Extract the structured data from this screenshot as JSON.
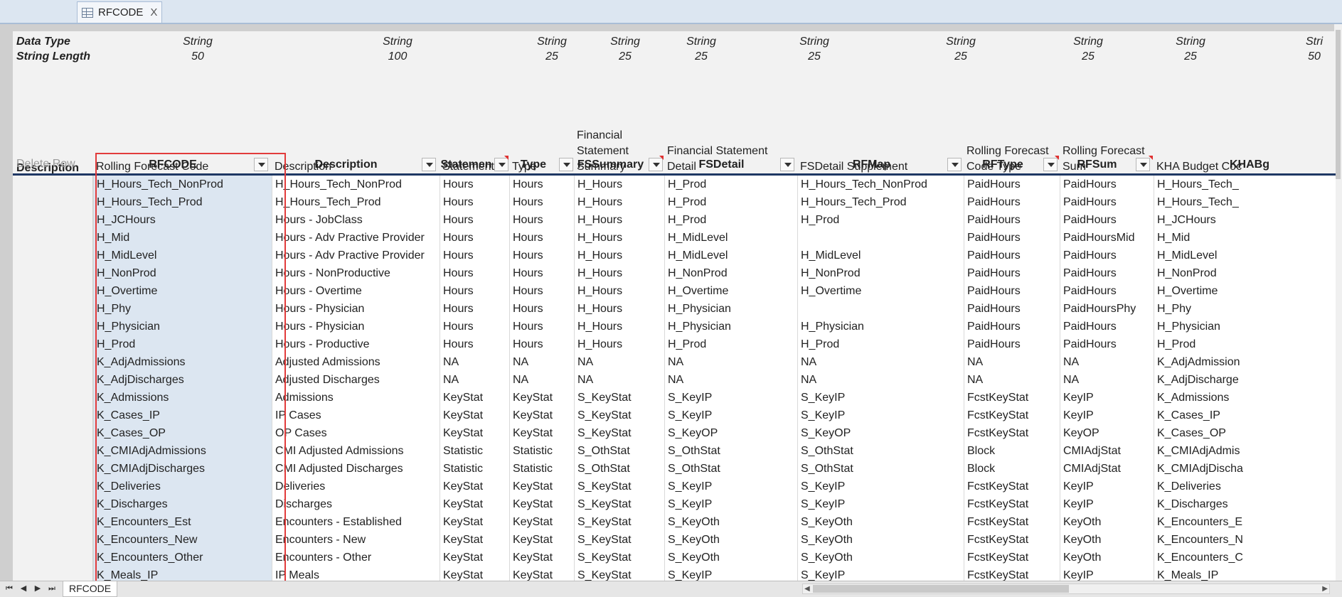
{
  "tab": {
    "title": "RFCODE",
    "close": "X"
  },
  "meta": {
    "data_type_label": "Data Type",
    "string_length_label": "String Length",
    "types": [
      "String",
      "String",
      "String",
      "String",
      "String",
      "String",
      "String",
      "String",
      "String",
      "Stri"
    ],
    "lengths": [
      "50",
      "100",
      "25",
      "25",
      "25",
      "25",
      "25",
      "25",
      "25",
      "50"
    ]
  },
  "description_label": "Description",
  "column_descriptions": [
    "Rolling Forecast Code",
    "Description",
    "Statement",
    "Type",
    "Financial Statement Summary",
    "Financial Statement Detail",
    "FSDetail Supplement",
    "Rolling Forecast Code Type",
    "Rolling Forecast Sum",
    "KHA Budget Coc"
  ],
  "delete_row_label": "Delete Row",
  "columns": [
    "RFCODE",
    "Description",
    "Statemen",
    "Type",
    "FSSummary",
    "FSDetail",
    "RFMap",
    "RFType",
    "RFSum",
    "KHABg"
  ],
  "rows": [
    [
      "H_Hours_Tech_NonProd",
      "H_Hours_Tech_NonProd",
      "Hours",
      "Hours",
      "H_Hours",
      "H_Prod",
      "H_Hours_Tech_NonProd",
      "PaidHours",
      "PaidHours",
      "H_Hours_Tech_"
    ],
    [
      "H_Hours_Tech_Prod",
      "H_Hours_Tech_Prod",
      "Hours",
      "Hours",
      "H_Hours",
      "H_Prod",
      "H_Hours_Tech_Prod",
      "PaidHours",
      "PaidHours",
      "H_Hours_Tech_"
    ],
    [
      "H_JCHours",
      "Hours - JobClass",
      "Hours",
      "Hours",
      "H_Hours",
      "H_Prod",
      "H_Prod",
      "PaidHours",
      "PaidHours",
      "H_JCHours"
    ],
    [
      "H_Mid",
      "Hours - Adv Practive Provider",
      "Hours",
      "Hours",
      "H_Hours",
      "H_MidLevel",
      "",
      "PaidHours",
      "PaidHoursMid",
      "H_Mid"
    ],
    [
      "H_MidLevel",
      "Hours - Adv Practive Provider",
      "Hours",
      "Hours",
      "H_Hours",
      "H_MidLevel",
      "H_MidLevel",
      "PaidHours",
      "PaidHours",
      "H_MidLevel"
    ],
    [
      "H_NonProd",
      "Hours - NonProductive",
      "Hours",
      "Hours",
      "H_Hours",
      "H_NonProd",
      "H_NonProd",
      "PaidHours",
      "PaidHours",
      "H_NonProd"
    ],
    [
      "H_Overtime",
      "Hours - Overtime",
      "Hours",
      "Hours",
      "H_Hours",
      "H_Overtime",
      "H_Overtime",
      "PaidHours",
      "PaidHours",
      "H_Overtime"
    ],
    [
      "H_Phy",
      "Hours - Physician",
      "Hours",
      "Hours",
      "H_Hours",
      "H_Physician",
      "",
      "PaidHours",
      "PaidHoursPhy",
      "H_Phy"
    ],
    [
      "H_Physician",
      "Hours - Physician",
      "Hours",
      "Hours",
      "H_Hours",
      "H_Physician",
      "H_Physician",
      "PaidHours",
      "PaidHours",
      "H_Physician"
    ],
    [
      "H_Prod",
      "Hours - Productive",
      "Hours",
      "Hours",
      "H_Hours",
      "H_Prod",
      "H_Prod",
      "PaidHours",
      "PaidHours",
      "H_Prod"
    ],
    [
      "K_AdjAdmissions",
      "Adjusted Admissions",
      "NA",
      "NA",
      "NA",
      "NA",
      "NA",
      "NA",
      "NA",
      "K_AdjAdmission"
    ],
    [
      "K_AdjDischarges",
      "Adjusted Discharges",
      "NA",
      "NA",
      "NA",
      "NA",
      "NA",
      "NA",
      "NA",
      "K_AdjDischarge"
    ],
    [
      "K_Admissions",
      "Admissions",
      "KeyStat",
      "KeyStat",
      "S_KeyStat",
      "S_KeyIP",
      "S_KeyIP",
      "FcstKeyStat",
      "KeyIP",
      "K_Admissions"
    ],
    [
      "K_Cases_IP",
      "IP Cases",
      "KeyStat",
      "KeyStat",
      "S_KeyStat",
      "S_KeyIP",
      "S_KeyIP",
      "FcstKeyStat",
      "KeyIP",
      "K_Cases_IP"
    ],
    [
      "K_Cases_OP",
      "OP Cases",
      "KeyStat",
      "KeyStat",
      "S_KeyStat",
      "S_KeyOP",
      "S_KeyOP",
      "FcstKeyStat",
      "KeyOP",
      "K_Cases_OP"
    ],
    [
      "K_CMIAdjAdmissions",
      "CMI Adjusted Admissions",
      "Statistic",
      "Statistic",
      "S_OthStat",
      "S_OthStat",
      "S_OthStat",
      "Block",
      "CMIAdjStat",
      "K_CMIAdjAdmis"
    ],
    [
      "K_CMIAdjDischarges",
      "CMI Adjusted Discharges",
      "Statistic",
      "Statistic",
      "S_OthStat",
      "S_OthStat",
      "S_OthStat",
      "Block",
      "CMIAdjStat",
      "K_CMIAdjDischa"
    ],
    [
      "K_Deliveries",
      "Deliveries",
      "KeyStat",
      "KeyStat",
      "S_KeyStat",
      "S_KeyIP",
      "S_KeyIP",
      "FcstKeyStat",
      "KeyIP",
      "K_Deliveries"
    ],
    [
      "K_Discharges",
      "Discharges",
      "KeyStat",
      "KeyStat",
      "S_KeyStat",
      "S_KeyIP",
      "S_KeyIP",
      "FcstKeyStat",
      "KeyIP",
      "K_Discharges"
    ],
    [
      "K_Encounters_Est",
      "Encounters - Established",
      "KeyStat",
      "KeyStat",
      "S_KeyStat",
      "S_KeyOth",
      "S_KeyOth",
      "FcstKeyStat",
      "KeyOth",
      "K_Encounters_E"
    ],
    [
      "K_Encounters_New",
      "Encounters - New",
      "KeyStat",
      "KeyStat",
      "S_KeyStat",
      "S_KeyOth",
      "S_KeyOth",
      "FcstKeyStat",
      "KeyOth",
      "K_Encounters_N"
    ],
    [
      "K_Encounters_Other",
      "Encounters - Other",
      "KeyStat",
      "KeyStat",
      "S_KeyStat",
      "S_KeyOth",
      "S_KeyOth",
      "FcstKeyStat",
      "KeyOth",
      "K_Encounters_C"
    ],
    [
      "K_Meals_IP",
      "IP Meals",
      "KeyStat",
      "KeyStat",
      "S_KeyStat",
      "S_KeyIP",
      "S_KeyIP",
      "FcstKeyStat",
      "KeyIP",
      "K_Meals_IP"
    ]
  ],
  "sheet_tab": "RFCODE",
  "nav": {
    "first": "⏮",
    "prev": "◀",
    "next": "▶",
    "last": "⏭"
  },
  "accent_selection": "#e23b3b"
}
